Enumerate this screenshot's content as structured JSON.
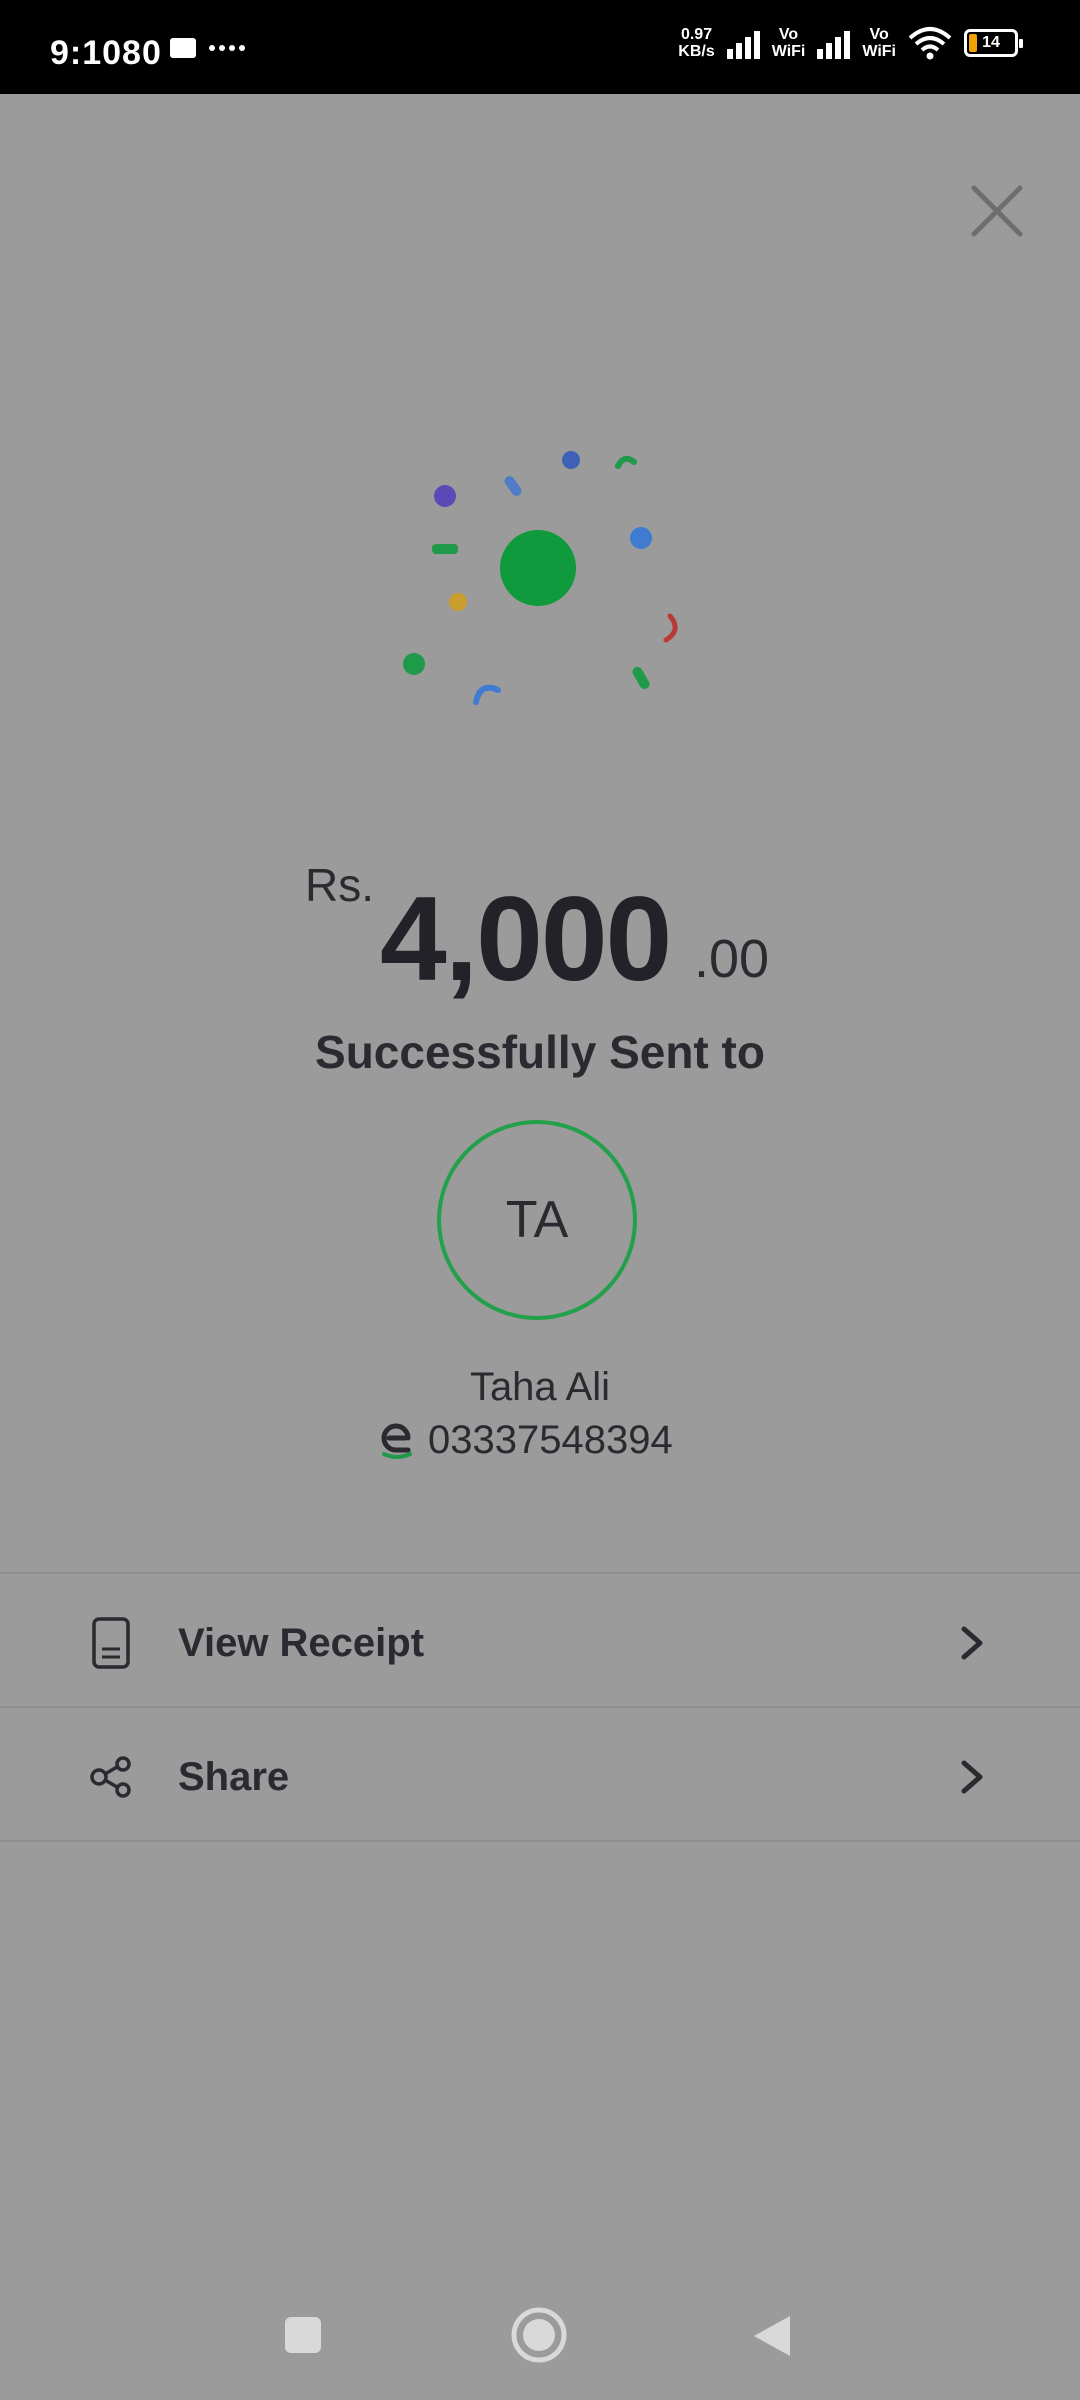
{
  "status_bar": {
    "time": "9:1080",
    "net_speed_top": "0.97",
    "net_speed_bottom": "KB/s",
    "vowifi_1": "Vo\nWiFi",
    "vowifi_2": "Vo\nWiFi",
    "battery_level": "14",
    "icons": [
      "message-icon",
      "more-dots-icon",
      "bluetooth-icon",
      "signal-icon",
      "signal-icon",
      "wifi-icon",
      "battery-icon"
    ]
  },
  "close_icon": "close-icon",
  "celebration_icon": "confetti-icon",
  "payment": {
    "currency": "Rs.",
    "amount_major": "4,000",
    "amount_minor": ".00",
    "status_text": "Successfully Sent to"
  },
  "recipient": {
    "initials": "TA",
    "name": "Taha Ali",
    "phone": "03337548394",
    "wallet_icon": "easypaisa-icon"
  },
  "actions": [
    {
      "label": "View Receipt",
      "icon": "receipt-icon"
    },
    {
      "label": "Share",
      "icon": "share-icon"
    }
  ],
  "colors": {
    "overlay_bg": "#9b9b9b",
    "accent_green": "#22a04a",
    "text": "#2a2a30"
  },
  "nav": [
    "recent-apps-icon",
    "home-icon",
    "back-icon"
  ]
}
